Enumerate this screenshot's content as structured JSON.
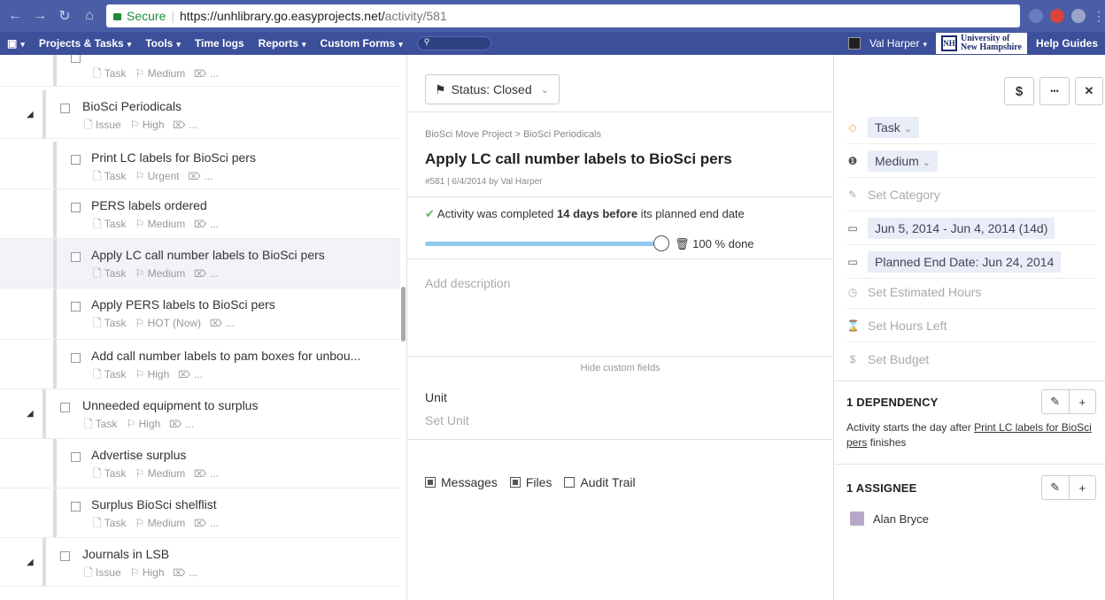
{
  "browser": {
    "secure_label": "Secure",
    "url_host": "https://unhlibrary.go.easyprojects.net/",
    "url_path": "activity/581"
  },
  "appbar": {
    "menu": [
      "Projects & Tasks",
      "Tools",
      "Time logs",
      "Reports",
      "Custom Forms"
    ],
    "user": "Val Harper",
    "logo_line1": "University of",
    "logo_line2": "New Hampshire",
    "logo_seal": "NH",
    "help": "Help Guides"
  },
  "tasks": [
    {
      "title": "",
      "type": "Task",
      "priority": "Medium",
      "tags": "...",
      "level": 1
    },
    {
      "title": "BioSci Periodicals",
      "type": "Issue",
      "priority": "High",
      "tags": "...",
      "level": 0
    },
    {
      "title": "Print LC labels for BioSci pers",
      "type": "Task",
      "priority": "Urgent",
      "tags": "...",
      "level": 1
    },
    {
      "title": "PERS labels ordered",
      "type": "Task",
      "priority": "Medium",
      "tags": "...",
      "level": 1
    },
    {
      "title": "Apply LC call number labels to BioSci pers",
      "type": "Task",
      "priority": "Medium",
      "tags": "...",
      "level": 1,
      "selected": true
    },
    {
      "title": "Apply PERS labels to BioSci pers",
      "type": "Task",
      "priority": "HOT (Now)",
      "tags": "...",
      "level": 1
    },
    {
      "title": "Add call number labels to pam boxes for unbou...",
      "type": "Task",
      "priority": "High",
      "tags": "...",
      "level": 1
    },
    {
      "title": "Unneeded equipment to surplus",
      "type": "Task",
      "priority": "High",
      "tags": "...",
      "level": 0
    },
    {
      "title": "Advertise surplus",
      "type": "Task",
      "priority": "Medium",
      "tags": "...",
      "level": 1
    },
    {
      "title": "Surplus BioSci shelflist",
      "type": "Task",
      "priority": "Medium",
      "tags": "...",
      "level": 1
    },
    {
      "title": "Journals in LSB",
      "type": "Issue",
      "priority": "High",
      "tags": "...",
      "level": 0
    }
  ],
  "detail": {
    "status": "Status: Closed",
    "breadcrumb": "BioSci Move Project > BioSci Periodicals",
    "title": "Apply LC call number labels to BioSci pers",
    "subinfo": "#581 | 6/4/2014 by Val Harper",
    "completed_pre": "Activity was completed ",
    "completed_bold": "14 days before",
    "completed_post": " its planned end date",
    "progress": 100,
    "progress_text": "100 % done",
    "description_placeholder": "Add description",
    "hide_custom_fields": "Hide custom fields",
    "unit_label": "Unit",
    "unit_placeholder": "Set Unit",
    "tabs": [
      {
        "label": "Messages",
        "checked": true
      },
      {
        "label": "Files",
        "checked": true
      },
      {
        "label": "Audit Trail",
        "checked": false
      }
    ]
  },
  "toolbar": {
    "dollar": "$",
    "more": "•••",
    "close": "✕"
  },
  "props": {
    "type": "Task",
    "priority": "Medium",
    "category": "Set Category",
    "dates": "Jun 5, 2014 - Jun 4, 2014 (14d)",
    "planned_end": "Planned End Date: Jun 24, 2014",
    "est_hours": "Set Estimated Hours",
    "hours_left": "Set Hours Left",
    "budget": "Set Budget"
  },
  "dependency": {
    "heading": "1 DEPENDENCY",
    "text_pre": "Activity starts the day after ",
    "link": "Print LC labels for BioSci pers",
    "text_post": " finishes"
  },
  "assignee": {
    "heading": "1 ASSIGNEE",
    "name": "Alan Bryce"
  },
  "colors": {
    "accent": "#3c4f9a",
    "progress": "#8fc9ef",
    "chip": "#e8edf7"
  }
}
